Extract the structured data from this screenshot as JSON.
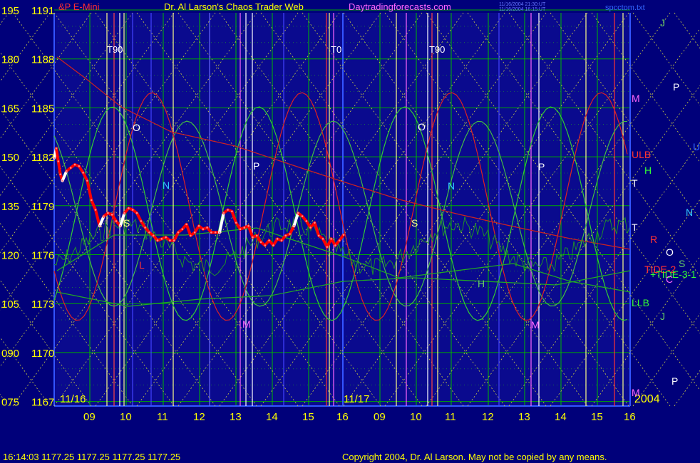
{
  "header": {
    "title_left": "&P E-Mini",
    "title_main": "Dr. Al Larson's Chaos Trader Web",
    "title_site": "Daytradingforecasts.com",
    "stamp_1": "11/16/2004 21:30:UT",
    "stamp_2": "11/16/2004 16:15:UT",
    "file": "spcctom.txt"
  },
  "footer": {
    "quote": "16:14:03  1177.25 1177.25 1177.25 1177.25",
    "copyright": "Copyright 2004, Dr. Al Larson. May not be copied by any means."
  },
  "colors": {
    "background": "#00007a",
    "plot_bg": "#0a0a8e",
    "grid": "#00cc00",
    "price": "#ff0000",
    "price_up": "#ffffff",
    "axis_label": "#ffff00"
  },
  "chart_data": {
    "type": "line",
    "title": "Dr. Al Larson's Chaos Trader Web",
    "y_left_angle": [
      "195",
      "180",
      "165",
      "150",
      "135",
      "120",
      "105",
      "090",
      "075"
    ],
    "y_left_price": [
      "1191",
      "1188",
      "1185",
      "1182",
      "1179",
      "1176",
      "1173",
      "1170",
      "1167"
    ],
    "ylim": [
      1167,
      1191
    ],
    "x_hours": [
      "09",
      "10",
      "11",
      "12",
      "13",
      "14",
      "15",
      "16",
      "09",
      "10",
      "11",
      "12",
      "13",
      "14",
      "15",
      "16"
    ],
    "date_labels": [
      "11/16",
      "11/17"
    ],
    "year_label": "2004",
    "series": [
      {
        "name": "",
        "x": [
          0,
          0.05,
          0.1,
          0.15,
          0.2,
          0.3,
          0.4,
          0.5,
          0.6,
          0.7,
          0.8,
          0.9,
          1.0,
          1.1,
          1.2,
          1.3,
          1.4,
          1.5,
          1.6,
          1.7,
          1.8,
          1.9,
          2.0,
          2.1,
          2.2,
          2.3,
          2.4,
          2.5,
          2.6,
          2.7,
          2.8,
          2.9,
          3.0,
          3.1,
          3.2,
          3.3,
          3.4,
          3.5,
          3.6,
          3.7,
          3.8,
          3.9,
          4.0,
          4.1,
          4.2,
          4.3,
          4.4,
          4.5,
          4.6,
          4.7,
          4.8,
          4.9,
          5.0,
          5.1,
          5.2,
          5.3,
          5.4,
          5.5,
          5.6,
          5.7,
          5.8,
          5.9,
          6.0,
          6.1,
          6.2,
          6.3,
          6.4,
          6.5,
          6.6,
          6.7,
          6.8,
          6.9,
          7.0
        ],
        "values": [
          1182.0,
          1182.6,
          1181.8,
          1181.0,
          1180.6,
          1181.2,
          1181.4,
          1181.6,
          1181.5,
          1181.1,
          1180.6,
          1179.4,
          1178.8,
          1177.8,
          1178.4,
          1178.6,
          1178.5,
          1178.1,
          1177.8,
          1178.6,
          1178.9,
          1178.8,
          1178.6,
          1178.1,
          1177.7,
          1177.4,
          1177.2,
          1176.9,
          1177.0,
          1177.1,
          1176.9,
          1176.9,
          1177.4,
          1177.6,
          1177.9,
          1177.2,
          1177.4,
          1177.8,
          1177.6,
          1177.7,
          1177.4,
          1177.4,
          1177.4,
          1178.6,
          1178.8,
          1178.7,
          1178.0,
          1177.6,
          1177.7,
          1177.8,
          1177.1,
          1177.2,
          1176.8,
          1176.6,
          1176.9,
          1176.6,
          1177.0,
          1176.9,
          1177.2,
          1177.3,
          1177.8,
          1178.6,
          1178.4,
          1178.1,
          1177.7,
          1178.0,
          1177.2,
          1177.0,
          1176.5,
          1177.0,
          1176.6,
          1176.9,
          1177.25
        ]
      }
    ],
    "legend": "none",
    "grid": true,
    "annotations": {
      "top_marks": [
        "T90",
        "T0",
        "T90"
      ],
      "right_labels": [
        "J",
        "P",
        "M",
        "U",
        "ULB",
        "H",
        "T",
        "N",
        "T",
        "R",
        "O",
        "S",
        "TIDE-2",
        "+TIDE-3-1",
        "C",
        "LLB",
        "J",
        "P",
        "M"
      ],
      "in_chart_letters": [
        "O",
        "N",
        "P",
        "S",
        "L",
        "M",
        "O",
        "S",
        "N",
        "H",
        "P",
        "M"
      ]
    }
  }
}
